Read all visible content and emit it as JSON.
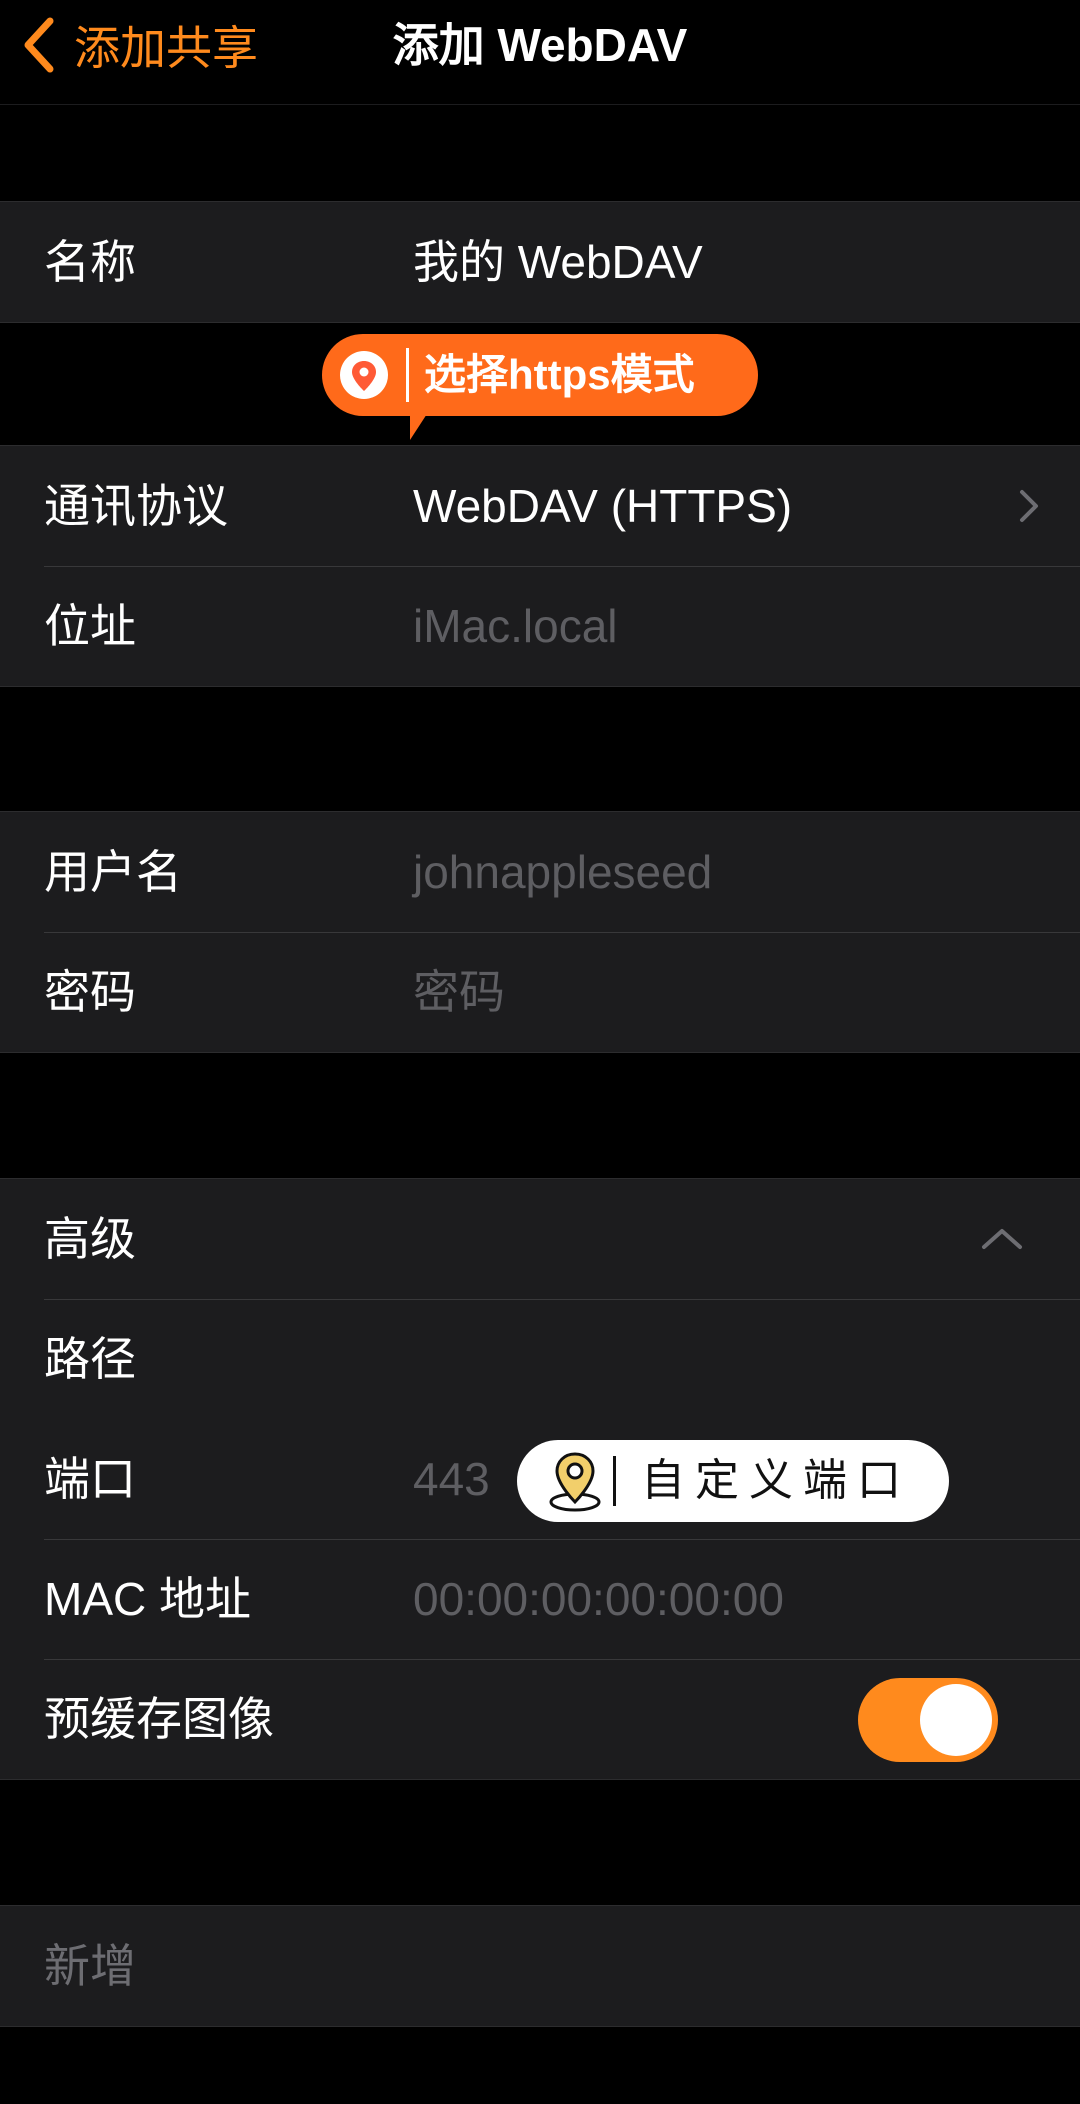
{
  "nav": {
    "back_label": "添加共享",
    "title": "添加 WebDAV"
  },
  "group1": {
    "name_label": "名称",
    "name_value": "我的 WebDAV"
  },
  "callout_https": "选择https模式",
  "group2": {
    "protocol_label": "通讯协议",
    "protocol_value": "WebDAV (HTTPS)",
    "address_label": "位址",
    "address_placeholder": "iMac.local"
  },
  "group3": {
    "username_label": "用户名",
    "username_placeholder": "johnappleseed",
    "password_label": "密码",
    "password_placeholder": "密码"
  },
  "group4": {
    "advanced_label": "高级",
    "path_label": "路径",
    "port_label": "端口",
    "port_placeholder": "443",
    "mac_label": "MAC 地址",
    "mac_placeholder": "00:00:00:00:00:00",
    "precache_label": "预缓存图像",
    "precache_on": true
  },
  "callout_port": "自定义端口",
  "group5": {
    "add_label": "新增"
  },
  "colors": {
    "accent": "#ff8a1d",
    "callout": "#ff6a1a",
    "cell_bg": "#1c1c1e",
    "placeholder": "#5e5e62"
  },
  "icons": [
    "chevron-left-icon",
    "chevron-right-icon",
    "chevron-up-icon",
    "location-pin-icon",
    "map-pin-icon"
  ]
}
